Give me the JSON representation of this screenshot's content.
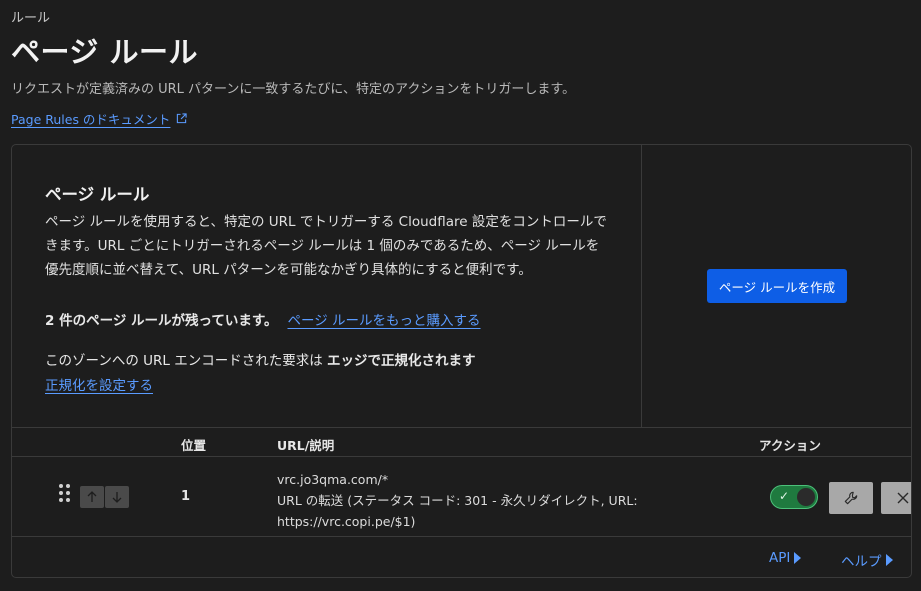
{
  "breadcrumb": "ルール",
  "page": {
    "title": "ページ ルール",
    "description": "リクエストが定義済みの URL パターンに一致するたびに、特定のアクションをトリガーします。",
    "doc_link": "Page Rules のドキュメント"
  },
  "intro": {
    "title": "ページ ルール",
    "body": "ページ ルールを使用すると、特定の URL でトリガーする Cloudflare 設定をコントロールできます。URL ごとにトリガーされるページ ルールは 1 個のみであるため、ページ ルールを優先度順に並べ替えて、URL パターンを可能なかぎり具体的にすると便利です。",
    "remaining_text": "2 件のページ ルールが残っています。",
    "buy_more_link": "ページ ルールをもっと購入する",
    "normalization_prefix": "このゾーンへの URL エンコードされた要求は ",
    "normalization_bold": "エッジで正規化されます",
    "normalization_link": "正規化を設定する",
    "create_button": "ページ ルールを作成"
  },
  "table": {
    "columns": {
      "position": "位置",
      "url": "URL/説明",
      "actions": "アクション"
    },
    "rows": [
      {
        "position": "1",
        "url": "vrc.jo3qma.com/*",
        "description": "URL の転送 (ステータス コード: 301 - 永久リダイレクト, URL: https://vrc.copi.pe/$1)",
        "enabled": true
      }
    ]
  },
  "footer": {
    "api_link": "API",
    "help_link": "ヘルプ"
  },
  "colors": {
    "accent": "#0e5ee6",
    "link": "#5a9bff",
    "toggle_on": "#1f7a3f"
  },
  "icons": {
    "external_link": "external-link-icon",
    "drag": "drag-handle-icon",
    "up": "arrow-up-icon",
    "down": "arrow-down-icon",
    "wrench": "wrench-icon",
    "close": "close-icon"
  }
}
